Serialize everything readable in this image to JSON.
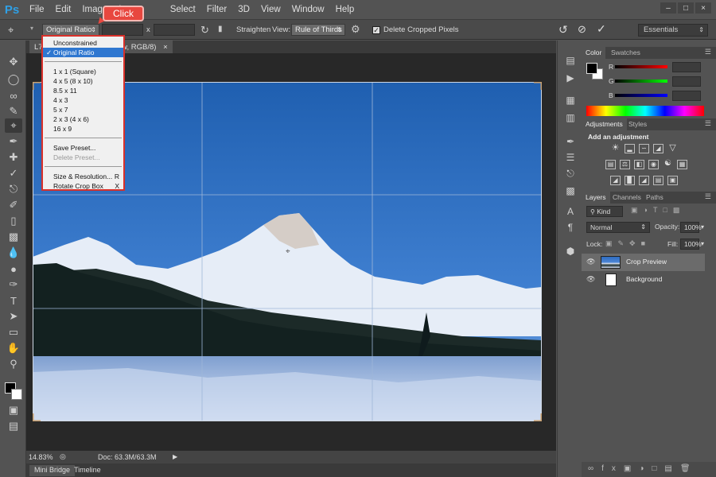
{
  "app": {
    "logo": "Ps"
  },
  "menu": [
    "File",
    "Edit",
    "Image",
    "L",
    "Select",
    "Filter",
    "3D",
    "View",
    "Window",
    "Help"
  ],
  "options": {
    "ratio_value": "Original Ratio",
    "x_separator": "x",
    "straighten_label": "Straighten",
    "view_label": "View:",
    "view_value": "Rule of Thirds",
    "delete_cropped_label": "Delete Cropped Pixels",
    "workspace": "Essentials"
  },
  "callout": {
    "text": "Click"
  },
  "document": {
    "tab_prefix": "L7",
    "tab_label": "Preview, RGB/8)",
    "zoom": "14.83%",
    "doc_info": "Doc: 63.3M/63.3M"
  },
  "bottom_tabs": [
    "Mini Bridge",
    "Timeline"
  ],
  "dropdown": {
    "items": [
      {
        "label": "Unconstrained",
        "shortcut": "",
        "selected": false,
        "disabled": false
      },
      {
        "label": "Original Ratio",
        "shortcut": "",
        "selected": true,
        "disabled": false
      },
      {
        "label": "1 x 1 (Square)",
        "shortcut": "",
        "selected": false,
        "disabled": false
      },
      {
        "label": "4 x 5 (8 x 10)",
        "shortcut": "",
        "selected": false,
        "disabled": false
      },
      {
        "label": "8.5 x 11",
        "shortcut": "",
        "selected": false,
        "disabled": false
      },
      {
        "label": "4 x 3",
        "shortcut": "",
        "selected": false,
        "disabled": false
      },
      {
        "label": "5 x 7",
        "shortcut": "",
        "selected": false,
        "disabled": false
      },
      {
        "label": "2 x 3 (4 x 6)",
        "shortcut": "",
        "selected": false,
        "disabled": false
      },
      {
        "label": "16 x 9",
        "shortcut": "",
        "selected": false,
        "disabled": false
      },
      {
        "label": "Save Preset...",
        "shortcut": "",
        "selected": false,
        "disabled": false
      },
      {
        "label": "Delete Preset...",
        "shortcut": "",
        "selected": false,
        "disabled": true
      },
      {
        "label": "Size & Resolution...",
        "shortcut": "R",
        "selected": false,
        "disabled": false
      },
      {
        "label": "Rotate Crop Box",
        "shortcut": "X",
        "selected": false,
        "disabled": false
      }
    ]
  },
  "panels": {
    "color_tabs": [
      "Color",
      "Swatches"
    ],
    "channels": [
      "R",
      "G",
      "B"
    ],
    "adjust_tabs": [
      "Adjustments",
      "Styles"
    ],
    "adjust_heading": "Add an adjustment",
    "layer_tabs": [
      "Layers",
      "Channels",
      "Paths"
    ],
    "filter_kind": "Kind",
    "blend_mode": "Normal",
    "opacity_label": "Opacity:",
    "opacity_value": "100%",
    "lock_label": "Lock:",
    "fill_label": "Fill:",
    "fill_value": "100%",
    "layers": [
      {
        "name": "Crop Preview",
        "selected": true
      },
      {
        "name": "Background",
        "selected": false
      }
    ]
  },
  "colors": {
    "accent": "#2f77d0",
    "callout": "#e8473f",
    "popup_border": "#d9302a"
  }
}
